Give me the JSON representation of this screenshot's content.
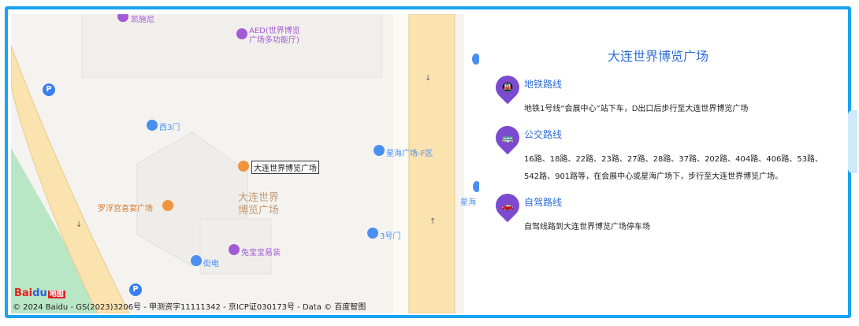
{
  "map": {
    "labels": {
      "aed": "AED(世界博览广场多功能厅)",
      "aed_line1": "AED(世界博览",
      "aed_line2": "广场多功能厅)",
      "kaisa": "凯施尼",
      "xi3men": "西3门",
      "xinghai": "星海广场-F区",
      "xinghai_short": "星海",
      "venue_marker": "大连世界博览广场",
      "venue_line1": "大连世界",
      "venue_line2": "博览广场",
      "luofu": "罗浮宫喜宴广场",
      "hao3men": "3号门",
      "tubao": "兔宝宝易装",
      "jiedian": "街电",
      "parking": "P"
    },
    "logo": {
      "bai": "Bai",
      "du": "du",
      "tag": "地图"
    },
    "copyright": "© 2024 Baidu - GS(2023)3206号 - 甲测资字11111342 - 京ICP证030173号 - Data © 百度智图"
  },
  "panel": {
    "title": "大连世界博览广场",
    "routes": [
      {
        "title": "地铁路线",
        "icon": "subway-icon",
        "icon_glyph": "🚇",
        "desc": "地铁1号线“会展中心”站下车，D出口后步行至大连世界博览广场"
      },
      {
        "title": "公交路线",
        "icon": "bus-icon",
        "icon_glyph": "🚌",
        "desc": "16路、18路、22路、23路、27路、28路、37路、202路、404路、406路、53路、542路、901路等，在会展中心或星海广场下，步行至大连世界博览广场。"
      },
      {
        "title": "自驾路线",
        "icon": "car-icon",
        "icon_glyph": "🚗",
        "desc": "自驾线路到大连世界博览广场停车场"
      }
    ]
  },
  "colors": {
    "frame": "#19a3f0",
    "accent": "#2f6fd7",
    "badge": "#7b4ad0"
  }
}
